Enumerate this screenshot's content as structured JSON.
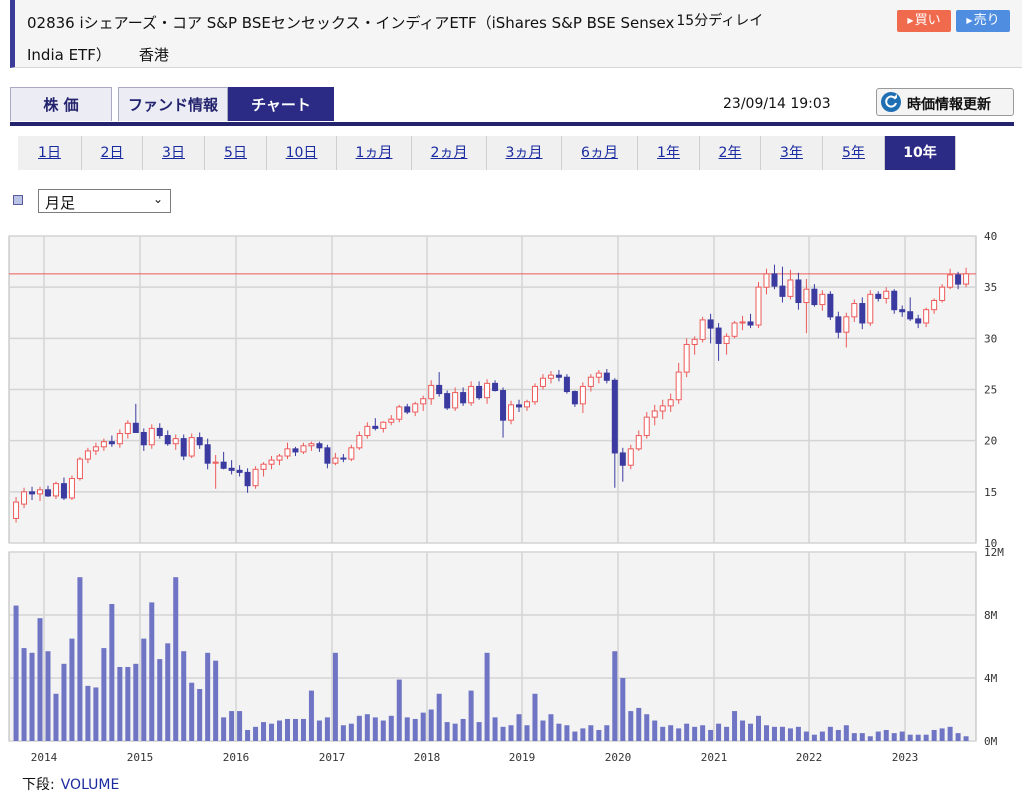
{
  "header": {
    "title": "02836 iシェアーズ・コア S&P BSEセンセックス・インディアETF（iShares S&P BSE Sensex",
    "delay": "15分ディレイ",
    "title_line2": "India ETF）",
    "market": "香港",
    "buy_label": "買い",
    "sell_label": "売り"
  },
  "tabs": [
    "株 価",
    "ファンド情報",
    "チャート"
  ],
  "active_tab": 2,
  "datetime": "23/09/14 19:03",
  "refresh_label": "時価情報更新",
  "periods": [
    "1日",
    "2日",
    "3日",
    "5日",
    "10日",
    "1ヵ月",
    "2ヵ月",
    "3ヵ月",
    "6ヵ月",
    "1年",
    "2年",
    "3年",
    "5年",
    "10年"
  ],
  "active_period": 13,
  "select": {
    "value": "月足"
  },
  "footer": {
    "label": "下段:",
    "link": "VOLUME"
  },
  "colors": {
    "up": "#ee5a5a",
    "down": "#3a3aa0",
    "volume": "#6f74c4",
    "reference_line": "#ee5a5a",
    "active": "#2b2b86"
  },
  "chart_data": [
    {
      "type": "candlestick",
      "title": "",
      "ylim": [
        10,
        40
      ],
      "yticks": [
        10,
        15,
        20,
        25,
        30,
        35,
        40
      ],
      "xticks": [
        "2014",
        "2015",
        "2016",
        "2017",
        "2018",
        "2019",
        "2020",
        "2021",
        "2022",
        "2023"
      ],
      "grid": true,
      "reference_line": 36.3,
      "series": [
        {
          "name": "月足",
          "ohlc": [
            [
              12.4,
              14.5,
              12.0,
              14.0
            ],
            [
              13.8,
              15.4,
              13.4,
              15.0
            ],
            [
              15.0,
              15.5,
              14.2,
              14.8
            ],
            [
              14.8,
              15.5,
              14.1,
              15.2
            ],
            [
              15.2,
              15.6,
              14.5,
              14.6
            ],
            [
              14.6,
              16.0,
              14.3,
              15.8
            ],
            [
              15.8,
              16.4,
              14.2,
              14.4
            ],
            [
              14.4,
              16.6,
              14.2,
              16.3
            ],
            [
              16.3,
              18.4,
              16.1,
              18.2
            ],
            [
              18.2,
              19.3,
              17.8,
              19.0
            ],
            [
              19.0,
              19.8,
              18.6,
              19.4
            ],
            [
              19.4,
              20.2,
              19.0,
              19.9
            ],
            [
              19.9,
              20.5,
              19.4,
              19.7
            ],
            [
              19.7,
              21.1,
              19.3,
              20.7
            ],
            [
              20.7,
              22.0,
              20.2,
              21.7
            ],
            [
              21.7,
              23.6,
              21.1,
              20.8
            ],
            [
              20.8,
              21.2,
              19.0,
              19.6
            ],
            [
              19.6,
              21.6,
              19.2,
              21.2
            ],
            [
              21.2,
              21.7,
              20.2,
              20.5
            ],
            [
              20.5,
              21.0,
              19.5,
              19.7
            ],
            [
              19.7,
              20.6,
              19.1,
              20.2
            ],
            [
              20.2,
              20.6,
              18.1,
              18.5
            ],
            [
              18.5,
              20.7,
              18.3,
              20.3
            ],
            [
              20.3,
              20.8,
              19.2,
              19.6
            ],
            [
              19.6,
              20.2,
              17.2,
              17.8
            ],
            [
              17.8,
              18.6,
              15.3,
              17.9
            ],
            [
              17.9,
              18.9,
              17.2,
              17.3
            ],
            [
              17.3,
              18.1,
              16.7,
              17.1
            ],
            [
              17.1,
              17.6,
              16.5,
              16.9
            ],
            [
              16.9,
              17.3,
              14.9,
              15.6
            ],
            [
              15.6,
              17.5,
              15.3,
              17.2
            ],
            [
              17.2,
              17.9,
              16.5,
              17.7
            ],
            [
              17.7,
              18.5,
              17.2,
              18.1
            ],
            [
              18.1,
              18.7,
              17.6,
              18.5
            ],
            [
              18.5,
              19.8,
              18.2,
              19.2
            ],
            [
              19.2,
              19.4,
              18.5,
              18.9
            ],
            [
              18.9,
              19.8,
              18.7,
              19.5
            ],
            [
              19.5,
              19.9,
              19.0,
              19.7
            ],
            [
              19.7,
              19.9,
              18.9,
              19.3
            ],
            [
              19.3,
              19.6,
              17.3,
              17.8
            ],
            [
              17.8,
              18.8,
              17.6,
              18.3
            ],
            [
              18.3,
              18.7,
              17.9,
              18.2
            ],
            [
              18.2,
              19.6,
              18.0,
              19.3
            ],
            [
              19.3,
              20.9,
              19.1,
              20.5
            ],
            [
              20.5,
              21.8,
              20.2,
              21.4
            ],
            [
              21.4,
              22.2,
              21.0,
              21.2
            ],
            [
              21.2,
              21.9,
              20.8,
              21.8
            ],
            [
              21.8,
              22.5,
              21.5,
              22.1
            ],
            [
              22.1,
              23.5,
              21.8,
              23.3
            ],
            [
              23.3,
              23.6,
              22.6,
              22.8
            ],
            [
              22.8,
              23.8,
              22.4,
              23.6
            ],
            [
              23.6,
              24.4,
              22.9,
              24.1
            ],
            [
              24.1,
              25.9,
              23.5,
              25.4
            ],
            [
              25.4,
              26.7,
              24.3,
              24.6
            ],
            [
              24.6,
              24.9,
              23.0,
              23.2
            ],
            [
              23.2,
              25.2,
              22.9,
              24.7
            ],
            [
              24.7,
              25.2,
              23.4,
              23.7
            ],
            [
              23.7,
              25.8,
              23.4,
              25.3
            ],
            [
              25.3,
              25.8,
              24.0,
              24.2
            ],
            [
              24.2,
              26.0,
              23.6,
              25.6
            ],
            [
              25.6,
              25.9,
              24.8,
              24.9
            ],
            [
              24.9,
              25.2,
              20.3,
              22.0
            ],
            [
              22.0,
              23.9,
              21.6,
              23.5
            ],
            [
              23.5,
              24.0,
              22.8,
              23.3
            ],
            [
              23.3,
              24.0,
              22.9,
              23.8
            ],
            [
              23.8,
              25.6,
              23.5,
              25.3
            ],
            [
              25.3,
              26.5,
              25.0,
              26.1
            ],
            [
              26.1,
              26.8,
              25.6,
              26.4
            ],
            [
              26.4,
              26.9,
              25.8,
              26.2
            ],
            [
              26.2,
              26.5,
              24.6,
              24.8
            ],
            [
              24.8,
              24.9,
              23.3,
              23.6
            ],
            [
              23.6,
              25.7,
              22.7,
              25.3
            ],
            [
              25.3,
              26.5,
              24.8,
              26.2
            ],
            [
              26.2,
              26.9,
              25.6,
              26.6
            ],
            [
              26.6,
              27.0,
              25.6,
              25.9
            ],
            [
              25.9,
              26.1,
              15.4,
              18.8
            ],
            [
              18.8,
              19.3,
              16.0,
              17.6
            ],
            [
              17.6,
              19.6,
              17.2,
              19.2
            ],
            [
              19.2,
              21.0,
              19.0,
              20.5
            ],
            [
              20.5,
              22.8,
              20.2,
              22.3
            ],
            [
              22.3,
              23.5,
              21.5,
              22.9
            ],
            [
              22.9,
              24.0,
              22.1,
              23.4
            ],
            [
              23.4,
              24.6,
              22.8,
              24.0
            ],
            [
              24.0,
              27.6,
              23.6,
              26.7
            ],
            [
              26.7,
              30.0,
              26.2,
              29.4
            ],
            [
              29.4,
              30.2,
              28.4,
              29.9
            ],
            [
              29.9,
              32.1,
              29.6,
              31.8
            ],
            [
              31.8,
              32.4,
              29.5,
              31.0
            ],
            [
              31.0,
              31.5,
              27.8,
              29.5
            ],
            [
              29.5,
              30.5,
              28.4,
              30.2
            ],
            [
              30.2,
              31.7,
              30.0,
              31.5
            ],
            [
              31.5,
              32.2,
              30.8,
              31.6
            ],
            [
              31.6,
              32.4,
              31.0,
              31.3
            ],
            [
              31.3,
              35.5,
              31.0,
              35.0
            ],
            [
              35.0,
              36.8,
              34.3,
              36.3
            ],
            [
              36.3,
              37.2,
              34.8,
              35.1
            ],
            [
              35.1,
              37.0,
              33.5,
              34.1
            ],
            [
              34.1,
              36.7,
              33.8,
              35.7
            ],
            [
              35.7,
              36.4,
              32.8,
              33.5
            ],
            [
              33.5,
              35.8,
              30.5,
              34.8
            ],
            [
              34.8,
              35.3,
              33.1,
              33.3
            ],
            [
              33.3,
              34.7,
              32.7,
              34.3
            ],
            [
              34.3,
              34.6,
              31.8,
              32.1
            ],
            [
              32.1,
              32.6,
              30.0,
              30.6
            ],
            [
              30.6,
              32.5,
              29.1,
              32.1
            ],
            [
              32.1,
              33.8,
              31.6,
              33.4
            ],
            [
              33.4,
              34.0,
              30.9,
              31.5
            ],
            [
              31.5,
              34.7,
              31.2,
              34.3
            ],
            [
              34.3,
              34.6,
              33.6,
              33.9
            ],
            [
              33.9,
              35.0,
              33.4,
              34.6
            ],
            [
              34.6,
              34.8,
              32.4,
              32.8
            ],
            [
              32.8,
              33.2,
              32.1,
              32.6
            ],
            [
              32.6,
              34.0,
              31.7,
              31.9
            ],
            [
              31.9,
              32.3,
              31.0,
              31.5
            ],
            [
              31.5,
              33.0,
              31.1,
              32.8
            ],
            [
              32.8,
              33.9,
              32.4,
              33.7
            ],
            [
              33.7,
              35.3,
              33.5,
              35.0
            ],
            [
              35.0,
              36.8,
              34.8,
              36.2
            ],
            [
              36.2,
              36.5,
              34.8,
              35.3
            ],
            [
              35.3,
              36.9,
              35.0,
              36.3
            ]
          ]
        }
      ]
    },
    {
      "type": "bar",
      "title": "",
      "ylim": [
        0,
        12
      ],
      "yticks": [
        "0M",
        "4M",
        "8M",
        "12M"
      ],
      "xticks": [
        "2014",
        "2015",
        "2016",
        "2017",
        "2018",
        "2019",
        "2020",
        "2021",
        "2022",
        "2023"
      ],
      "grid": true,
      "series": [
        {
          "name": "VOLUME",
          "values": [
            8.6,
            5.9,
            5.6,
            7.8,
            5.7,
            3.0,
            4.9,
            6.5,
            10.4,
            3.5,
            3.4,
            5.9,
            8.7,
            4.7,
            4.7,
            4.9,
            6.5,
            8.8,
            5.2,
            6.2,
            10.4,
            5.7,
            3.7,
            3.3,
            5.6,
            5.1,
            1.5,
            1.9,
            1.9,
            0.7,
            0.9,
            1.2,
            1.1,
            1.3,
            1.4,
            1.4,
            1.4,
            3.2,
            1.3,
            1.5,
            5.6,
            1.0,
            1.1,
            1.6,
            1.7,
            1.5,
            1.3,
            1.6,
            3.9,
            1.5,
            1.4,
            1.8,
            2.0,
            3.0,
            1.2,
            1.1,
            1.4,
            3.2,
            1.2,
            5.6,
            1.5,
            0.9,
            1.0,
            1.7,
            1.0,
            3.0,
            1.3,
            1.7,
            1.1,
            1.0,
            0.6,
            0.8,
            1.0,
            0.7,
            1.0,
            5.7,
            4.0,
            1.9,
            2.1,
            1.7,
            1.3,
            0.9,
            1.0,
            0.8,
            1.1,
            0.9,
            1.0,
            0.7,
            1.1,
            0.9,
            1.9,
            1.3,
            1.1,
            1.6,
            1.0,
            0.9,
            0.9,
            0.8,
            0.9,
            0.6,
            0.4,
            0.6,
            0.9,
            0.7,
            1.0,
            0.5,
            0.5,
            0.3,
            0.6,
            0.7,
            0.5,
            0.6,
            0.4,
            0.4,
            0.4,
            0.7,
            0.8,
            0.9,
            0.5,
            0.3
          ]
        }
      ]
    }
  ]
}
